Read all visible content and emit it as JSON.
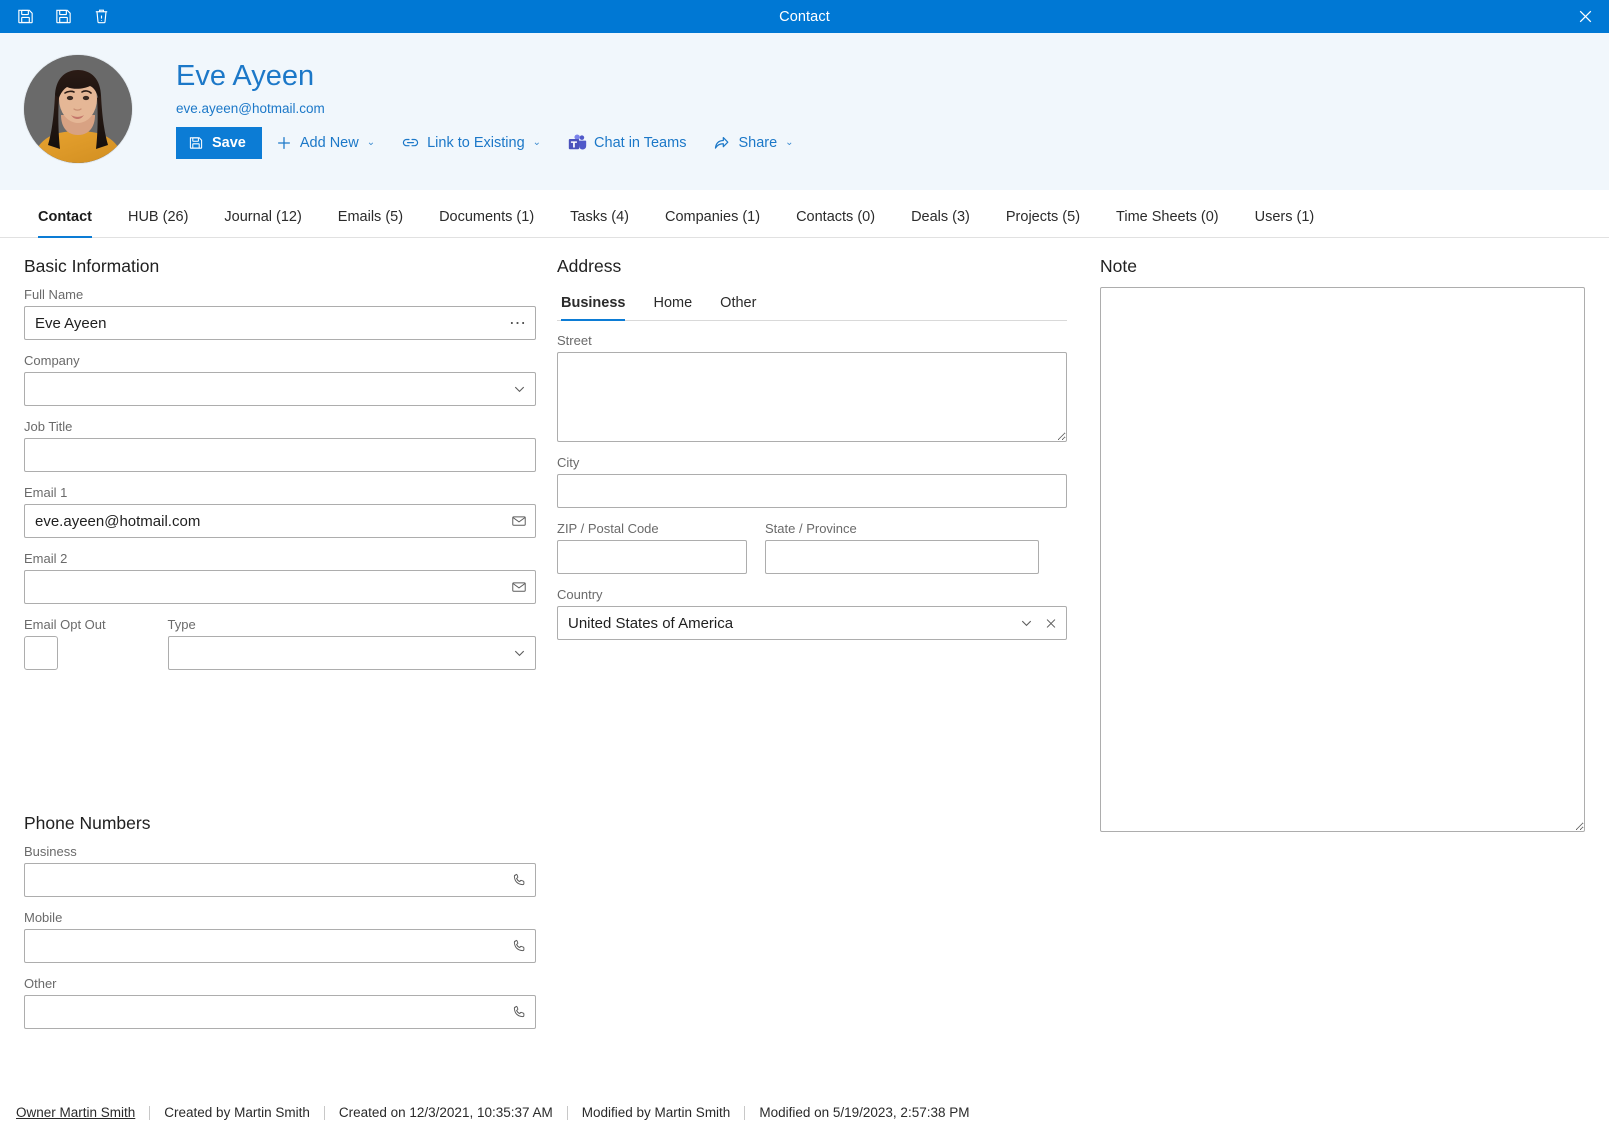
{
  "window": {
    "title": "Contact",
    "close_label": "✕",
    "toolbar": [
      {
        "name": "save-and-new-icon",
        "tip": "Save & New"
      },
      {
        "name": "save-icon",
        "tip": "Save"
      },
      {
        "name": "delete-icon",
        "tip": "Delete"
      }
    ]
  },
  "header": {
    "contact_name": "Eve Ayeen",
    "contact_email": "eve.ayeen@hotmail.com",
    "actions": {
      "save": "Save",
      "add_new": "Add New",
      "link_to_existing": "Link to Existing",
      "chat_in_teams": "Chat in Teams",
      "share": "Share",
      "chevron": "⌄"
    }
  },
  "tabs": [
    {
      "label": "Contact",
      "active": true
    },
    {
      "label": "HUB (26)",
      "active": false
    },
    {
      "label": "Journal (12)",
      "active": false
    },
    {
      "label": "Emails (5)",
      "active": false
    },
    {
      "label": "Documents (1)",
      "active": false
    },
    {
      "label": "Tasks (4)",
      "active": false
    },
    {
      "label": "Companies (1)",
      "active": false
    },
    {
      "label": "Contacts (0)",
      "active": false
    },
    {
      "label": "Deals (3)",
      "active": false
    },
    {
      "label": "Projects (5)",
      "active": false
    },
    {
      "label": "Time Sheets (0)",
      "active": false
    },
    {
      "label": "Users (1)",
      "active": false
    }
  ],
  "basic_information": {
    "title": "Basic Information",
    "full_name": {
      "label": "Full Name",
      "value": "Eve Ayeen",
      "placeholder": ""
    },
    "company": {
      "label": "Company",
      "value": "",
      "placeholder": ""
    },
    "job_title": {
      "label": "Job Title",
      "value": "",
      "placeholder": ""
    },
    "email1": {
      "label": "Email 1",
      "value": "eve.ayeen@hotmail.com",
      "placeholder": ""
    },
    "email2": {
      "label": "Email 2",
      "value": "",
      "placeholder": ""
    },
    "email_opt_out": {
      "label": "Email Opt Out",
      "checked": false
    },
    "type": {
      "label": "Type",
      "value": "",
      "placeholder": ""
    }
  },
  "address": {
    "title": "Address",
    "tabs": [
      {
        "label": "Business",
        "active": true
      },
      {
        "label": "Home",
        "active": false
      },
      {
        "label": "Other",
        "active": false
      }
    ],
    "street": {
      "label": "Street",
      "value": "",
      "placeholder": ""
    },
    "city": {
      "label": "City",
      "value": "",
      "placeholder": ""
    },
    "zip": {
      "label": "ZIP / Postal Code",
      "value": "",
      "placeholder": ""
    },
    "state": {
      "label": "State / Province",
      "value": "",
      "placeholder": ""
    },
    "country": {
      "label": "Country",
      "value": "United States of America",
      "placeholder": ""
    }
  },
  "note": {
    "title": "Note",
    "value": "",
    "placeholder": ""
  },
  "phone_numbers": {
    "title": "Phone Numbers",
    "business": {
      "label": "Business",
      "value": "",
      "placeholder": ""
    },
    "mobile": {
      "label": "Mobile",
      "value": "",
      "placeholder": ""
    },
    "other": {
      "label": "Other",
      "value": "",
      "placeholder": ""
    }
  },
  "footer": {
    "owner": "Owner Martin Smith",
    "created_by": "Created by Martin Smith",
    "created_on": "Created on 12/3/2021, 10:35:37 AM",
    "modified_by": "Modified by Martin Smith",
    "modified_on": "Modified on 5/19/2023, 2:57:38 PM"
  },
  "colors": {
    "titlebar_blue": "#0078D4",
    "accent_blue": "#0C7CD5",
    "link_blue": "#1C78C8",
    "header_bg": "#F1F7FC",
    "teams_purple": "#5059C9",
    "teams_light": "#7B83EB"
  }
}
